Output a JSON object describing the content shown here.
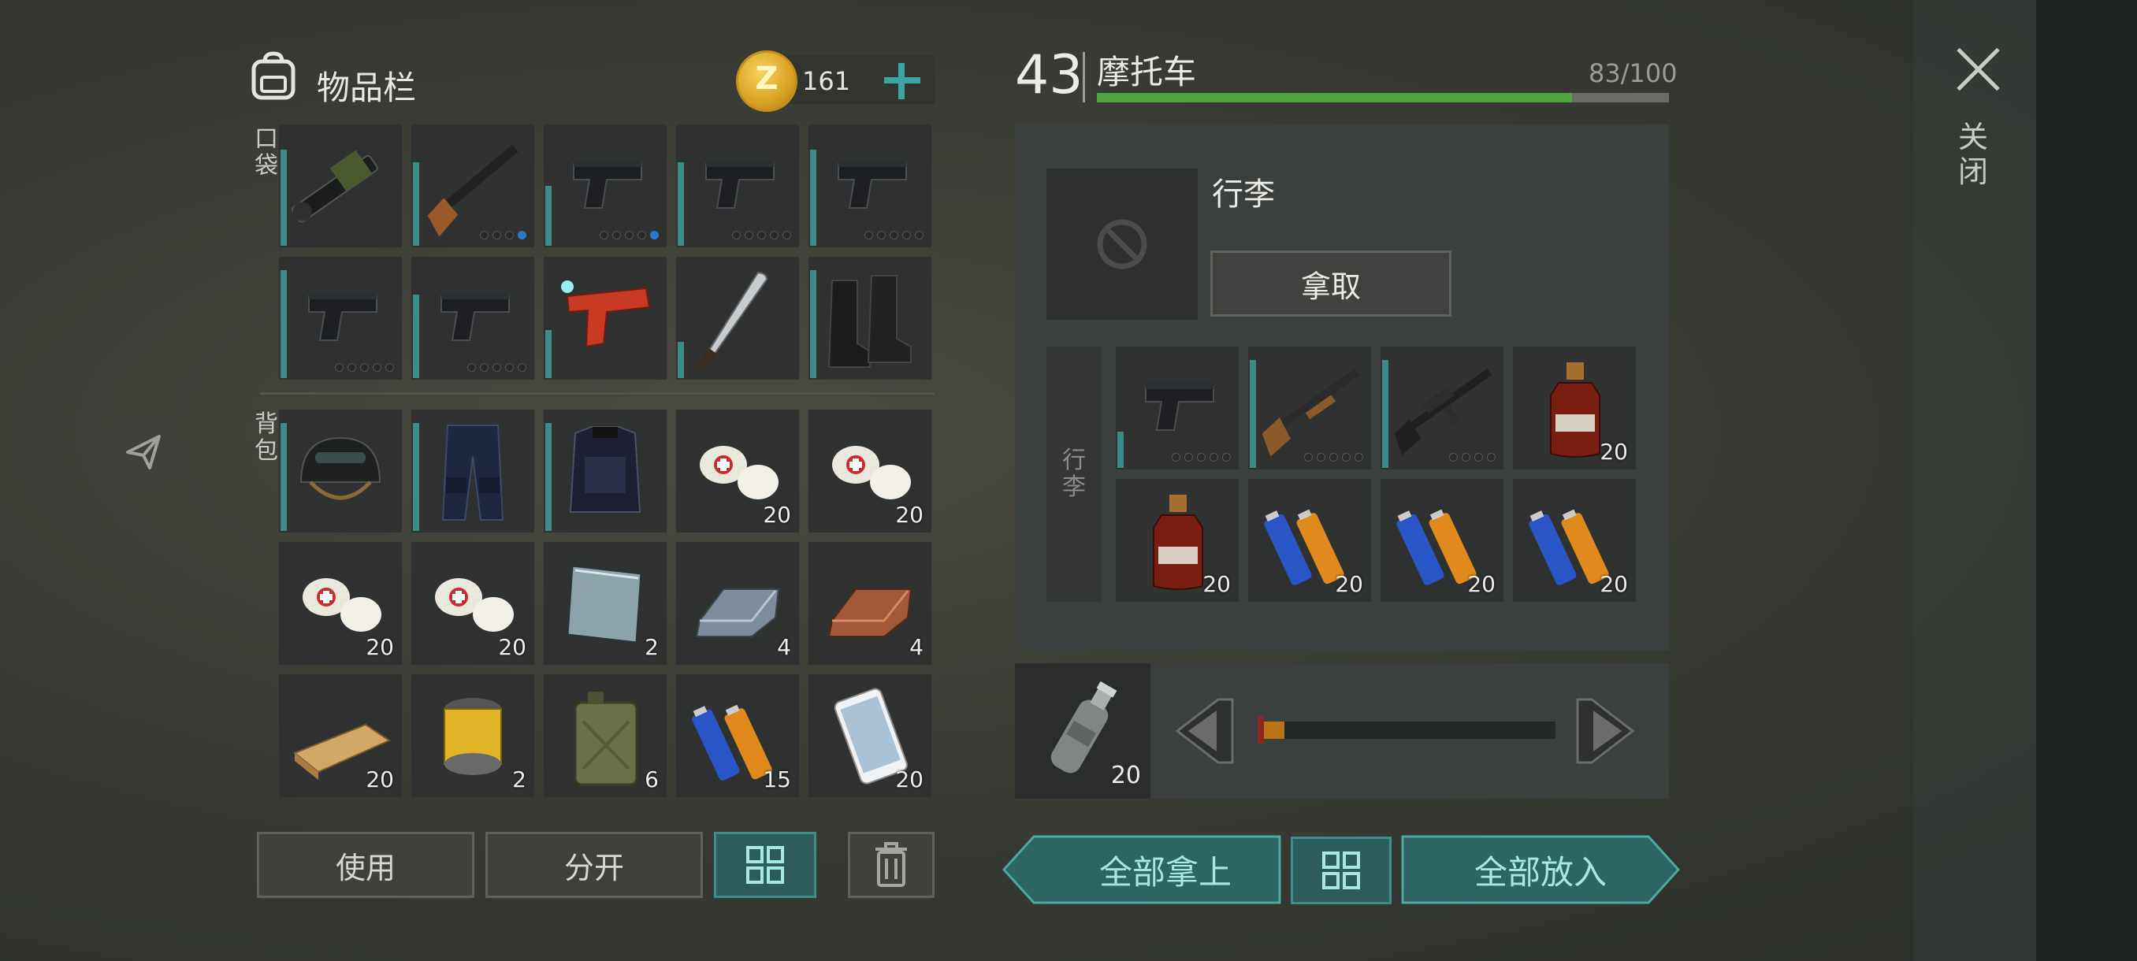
{
  "inventory": {
    "title": "物品栏",
    "coin_symbol": "Z",
    "coins": "161",
    "pocket_label": "口袋",
    "backpack_label": "背包",
    "pocket": [
      {
        "icon": "grenade-launcher-icon",
        "type": "launcher",
        "dur": 0.8
      },
      {
        "icon": "rifle-icon",
        "type": "rifle",
        "dur": 0.7,
        "dots": [
          0,
          0,
          0,
          1
        ]
      },
      {
        "icon": "pistol-icon",
        "type": "pistol",
        "dur": 0.5,
        "dots": [
          0,
          0,
          0,
          0,
          1
        ]
      },
      {
        "icon": "pistol-icon",
        "type": "pistol",
        "dur": 0.7,
        "dots": [
          0,
          0,
          0,
          0,
          0
        ]
      },
      {
        "icon": "pistol-icon",
        "type": "pistol",
        "dur": 0.8,
        "dots": [
          0,
          0,
          0,
          0,
          0
        ]
      },
      {
        "icon": "pistol-icon",
        "type": "pistol",
        "dur": 0.9,
        "dots": [
          0,
          0,
          0,
          0,
          0
        ]
      },
      {
        "icon": "pistol-icon",
        "type": "pistol",
        "dur": 0.7,
        "dots": [
          0,
          0,
          0,
          0,
          0
        ]
      },
      {
        "icon": "flare-gun-icon",
        "type": "flare",
        "dur": 0.4
      },
      {
        "icon": "machete-icon",
        "type": "machete",
        "dur": 0.3
      },
      {
        "icon": "boots-icon",
        "type": "boots",
        "dur": 0.9
      }
    ],
    "backpack": [
      {
        "icon": "helmet-icon",
        "type": "helmet",
        "dur": 0.9
      },
      {
        "icon": "armored-pants-icon",
        "type": "pants",
        "dur": 0.9
      },
      {
        "icon": "body-armor-icon",
        "type": "armor",
        "dur": 0.9
      },
      {
        "icon": "bandage-icon",
        "type": "bandage",
        "qty": "20"
      },
      {
        "icon": "bandage-icon",
        "type": "bandage",
        "qty": "20"
      },
      {
        "icon": "bandage-icon",
        "type": "bandage",
        "qty": "20"
      },
      {
        "icon": "bandage-icon",
        "type": "bandage",
        "qty": "20"
      },
      {
        "icon": "glass-plate-icon",
        "type": "plate",
        "qty": "2"
      },
      {
        "icon": "iron-ingot-icon",
        "type": "ingot",
        "qty": "4"
      },
      {
        "icon": "copper-ingot-icon",
        "type": "copper",
        "qty": "4"
      },
      {
        "icon": "wood-plank-icon",
        "type": "wood",
        "qty": "20"
      },
      {
        "icon": "air-filter-icon",
        "type": "filter",
        "qty": "2"
      },
      {
        "icon": "jerrycan-icon",
        "type": "jerrycan",
        "qty": "6"
      },
      {
        "icon": "batteries-icon",
        "type": "battery",
        "qty": "15"
      },
      {
        "icon": "smartphone-icon",
        "type": "phone",
        "qty": "20"
      }
    ],
    "buttons": {
      "use": "使用",
      "split": "分开"
    }
  },
  "vehicle": {
    "level": "43",
    "name": "摩托车",
    "capacity": "83/100",
    "capacity_fraction": 0.83,
    "luggage_title": "行李",
    "take_label": "拿取",
    "luggage_tab": "行李",
    "items": [
      {
        "icon": "pistol-icon",
        "type": "pistol",
        "dur": 0.3,
        "dots": [
          0,
          0,
          0,
          0,
          0
        ]
      },
      {
        "icon": "shotgun-icon",
        "type": "shotgun",
        "dur": 0.9,
        "dots": [
          0,
          0,
          0,
          0,
          0
        ]
      },
      {
        "icon": "assault-rifle-icon",
        "type": "ar",
        "dur": 0.9,
        "dots": [
          0,
          0,
          0,
          0
        ]
      },
      {
        "icon": "spirit-bottle-icon",
        "type": "spirit",
        "qty": "20"
      },
      {
        "icon": "spirit-bottle-icon",
        "type": "spirit",
        "qty": "20"
      },
      {
        "icon": "batteries-icon",
        "type": "battery",
        "qty": "20"
      },
      {
        "icon": "batteries-icon",
        "type": "battery",
        "qty": "20"
      },
      {
        "icon": "batteries-icon",
        "type": "battery",
        "qty": "20"
      }
    ],
    "selected_item": {
      "icon": "water-bottle-icon",
      "qty": "20"
    },
    "slider_fraction": 0.09,
    "take_all": "全部拿上",
    "put_all": "全部放入"
  },
  "close_label": "关闭",
  "colors": {
    "accent": "#3e8f8b",
    "capacity_bar": "#52a43e",
    "slider": "#b87416"
  }
}
